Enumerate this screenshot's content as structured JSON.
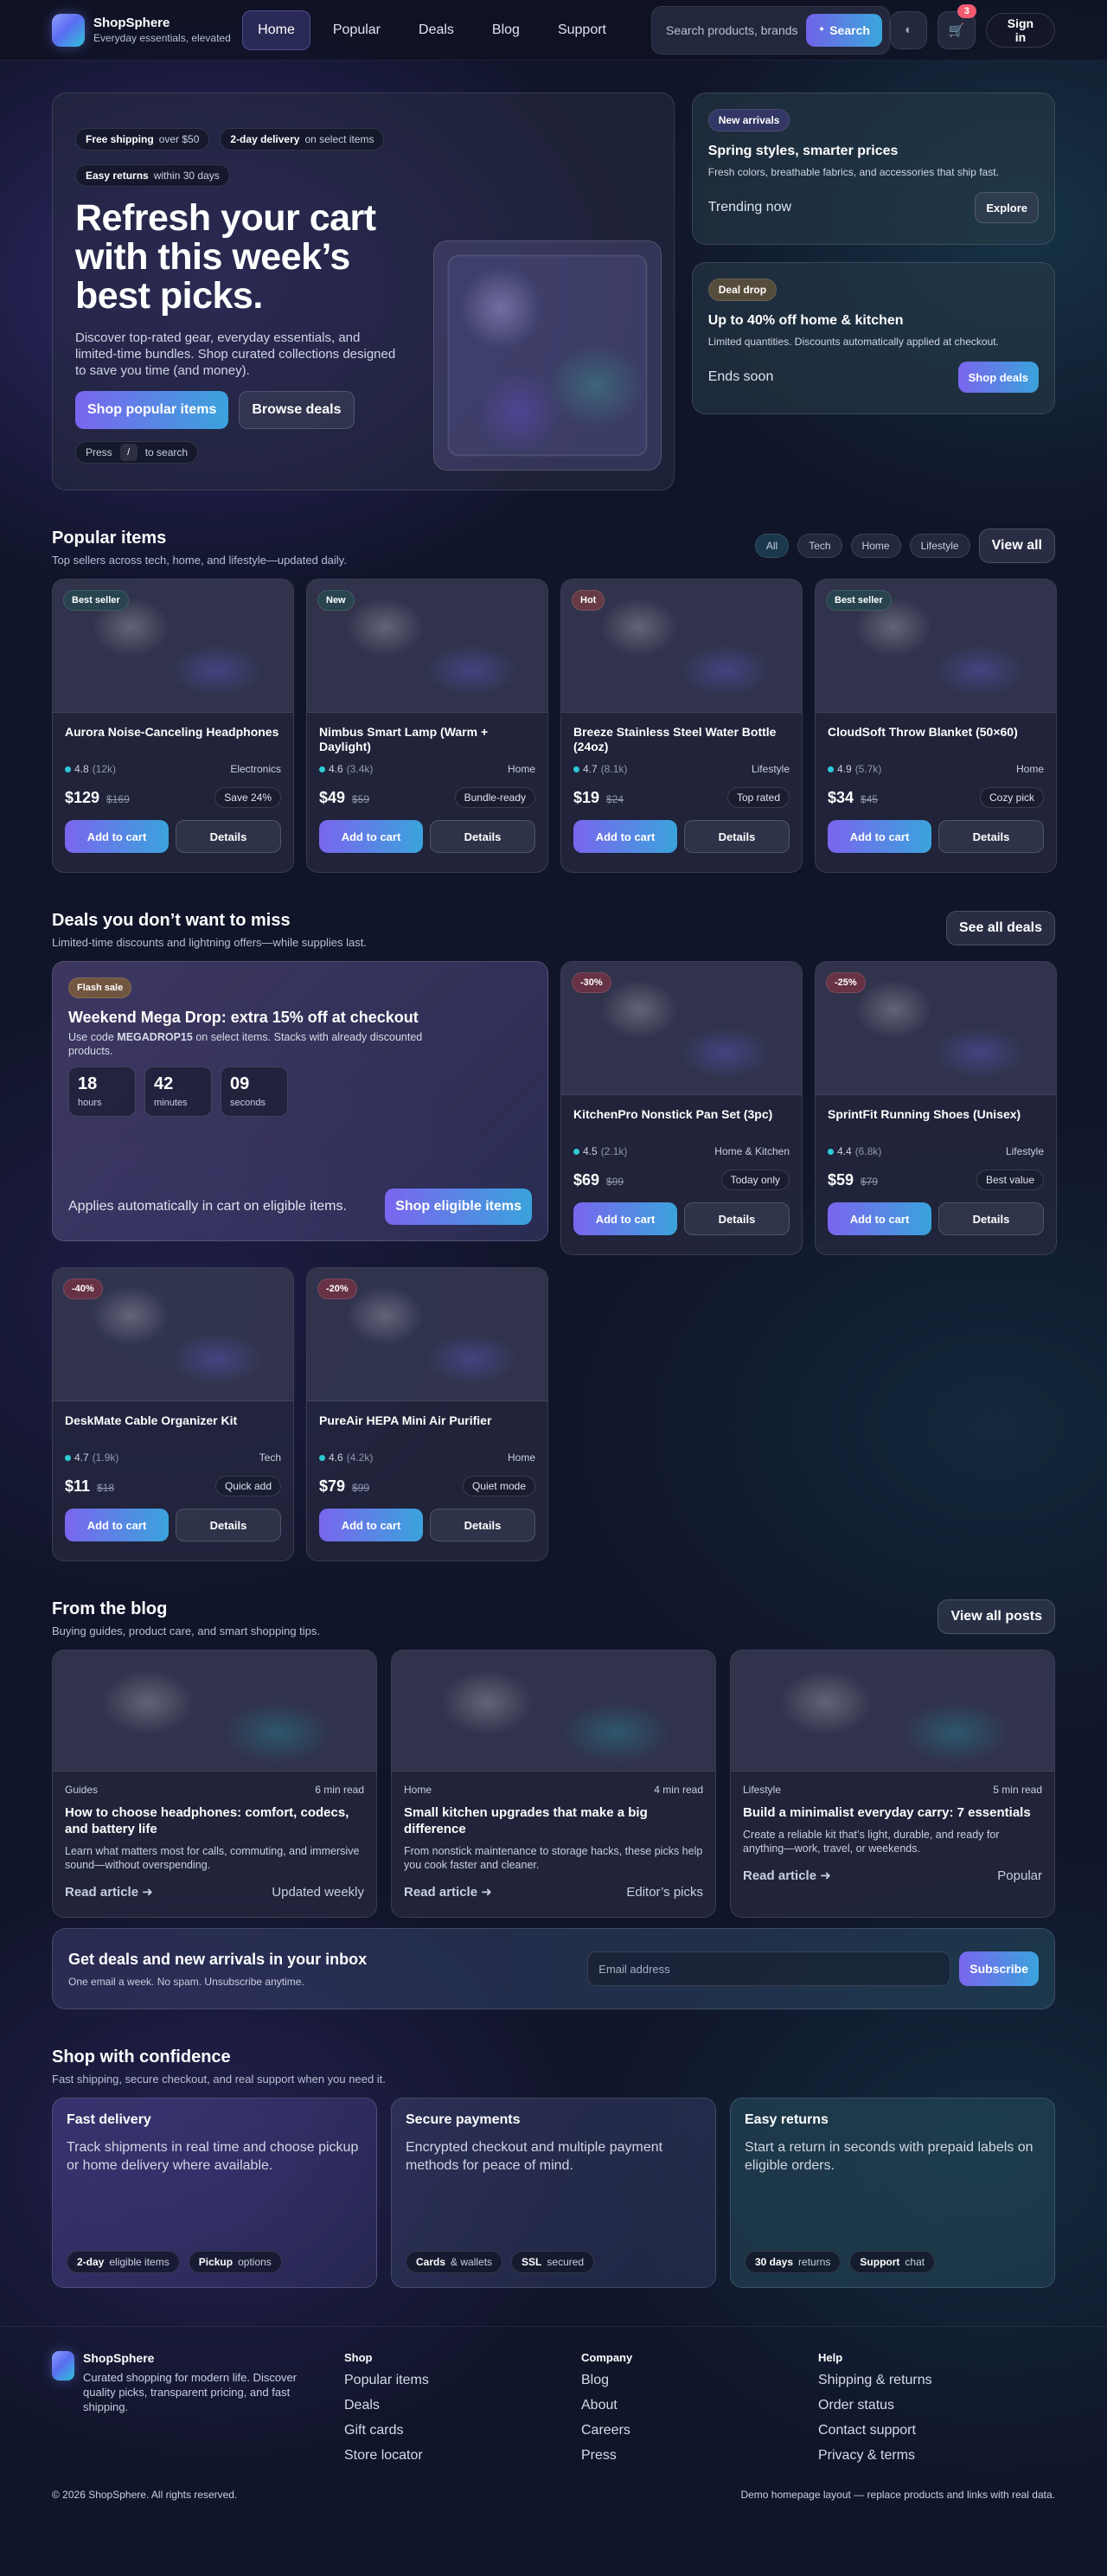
{
  "header": {
    "brand": "ShopSphere",
    "tagline": "Everyday essentials, elevated",
    "nav": [
      "Home",
      "Popular",
      "Deals",
      "Blog",
      "Support"
    ],
    "search_placeholder": "Search products, brands",
    "search_button": "Search",
    "cart_count": "3",
    "signin": "Sign in"
  },
  "hero": {
    "chips": [
      {
        "strong": "Free shipping",
        "text": "over $50"
      },
      {
        "strong": "2-day delivery",
        "text": "on select items"
      },
      {
        "strong": "Easy returns",
        "text": "within 30 days"
      }
    ],
    "title": "Refresh your cart with this week’s best picks.",
    "lead": "Discover top-rated gear, everyday essentials, and limited-time bundles. Shop curated collections designed to save you time (and money).",
    "cta_primary": "Shop popular items",
    "cta_secondary": "Browse deals",
    "hint_pre": "Press",
    "hint_key": "/",
    "hint_post": "to search"
  },
  "promos": [
    {
      "tag": "New arrivals",
      "title": "Spring styles, smarter prices",
      "desc": "Fresh colors, breathable fabrics, and accessories that ship fast.",
      "foot": "Trending now",
      "button": "Explore"
    },
    {
      "tag": "Deal drop",
      "title": "Up to 40% off home & kitchen",
      "desc": "Limited quantities. Discounts automatically applied at checkout.",
      "foot": "Ends soon",
      "button": "Shop deals"
    }
  ],
  "popular": {
    "title": "Popular items",
    "subtitle": "Top sellers across tech, home, and lifestyle—updated daily.",
    "filters": [
      "All",
      "Tech",
      "Home",
      "Lifestyle"
    ],
    "view_all": "View all",
    "products": [
      {
        "tag": "Best seller",
        "name": "Aurora Noise-Canceling Headphones",
        "rating": "4.8",
        "reviews": "(12k)",
        "category": "Electronics",
        "price": "$129",
        "old": "$169",
        "note": "Save 24%"
      },
      {
        "tag": "New",
        "name": "Nimbus Smart Lamp (Warm + Daylight)",
        "rating": "4.6",
        "reviews": "(3.4k)",
        "category": "Home",
        "price": "$49",
        "old": "$59",
        "note": "Bundle-ready"
      },
      {
        "tag": "Hot",
        "name": "Breeze Stainless Steel Water Bottle (24oz)",
        "rating": "4.7",
        "reviews": "(8.1k)",
        "category": "Lifestyle",
        "price": "$19",
        "old": "$24",
        "note": "Top rated"
      },
      {
        "tag": "Best seller",
        "name": "CloudSoft Throw Blanket (50×60)",
        "rating": "4.9",
        "reviews": "(5.7k)",
        "category": "Home",
        "price": "$34",
        "old": "$45",
        "note": "Cozy pick"
      }
    ],
    "add_label": "Add to cart",
    "details_label": "Details"
  },
  "deals": {
    "title": "Deals you don’t want to miss",
    "subtitle": "Limited-time discounts and lightning offers—while supplies last.",
    "see_all": "See all deals",
    "flash": {
      "tag": "Flash sale",
      "title": "Weekend Mega Drop: extra 15% off at checkout",
      "desc_pre": "Use code",
      "code": "MEGADROP15",
      "desc_post": "on select items. Stacks with already discounted products.",
      "timer": [
        {
          "n": "18",
          "l": "hours"
        },
        {
          "n": "42",
          "l": "minutes"
        },
        {
          "n": "09",
          "l": "seconds"
        }
      ],
      "foot": "Applies automatically in cart on eligible items.",
      "button": "Shop eligible items"
    },
    "products": [
      {
        "tag": "-30%",
        "name": "KitchenPro Nonstick Pan Set (3pc)",
        "rating": "4.5",
        "reviews": "(2.1k)",
        "category": "Home & Kitchen",
        "price": "$69",
        "old": "$99",
        "note": "Today only"
      },
      {
        "tag": "-25%",
        "name": "SprintFit Running Shoes (Unisex)",
        "rating": "4.4",
        "reviews": "(6.8k)",
        "category": "Lifestyle",
        "price": "$59",
        "old": "$79",
        "note": "Best value"
      },
      {
        "tag": "-40%",
        "name": "DeskMate Cable Organizer Kit",
        "rating": "4.7",
        "reviews": "(1.9k)",
        "category": "Tech",
        "price": "$11",
        "old": "$18",
        "note": "Quick add"
      },
      {
        "tag": "-20%",
        "name": "PureAir HEPA Mini Air Purifier",
        "rating": "4.6",
        "reviews": "(4.2k)",
        "category": "Home",
        "price": "$79",
        "old": "$99",
        "note": "Quiet mode"
      }
    ]
  },
  "blog": {
    "title": "From the blog",
    "subtitle": "Buying guides, product care, and smart shopping tips.",
    "view_all": "View all posts",
    "posts": [
      {
        "category": "Guides",
        "time": "6 min read",
        "title": "How to choose headphones: comfort, codecs, and battery life",
        "excerpt": "Learn what matters most for calls, commuting, and immersive sound—without overspending.",
        "link": "Read article",
        "label": "Updated weekly"
      },
      {
        "category": "Home",
        "time": "4 min read",
        "title": "Small kitchen upgrades that make a big difference",
        "excerpt": "From nonstick maintenance to storage hacks, these picks help you cook faster and cleaner.",
        "link": "Read article",
        "label": "Editor’s picks"
      },
      {
        "category": "Lifestyle",
        "time": "5 min read",
        "title": "Build a minimalist everyday carry: 7 essentials",
        "excerpt": "Create a reliable kit that’s light, durable, and ready for anything—work, travel, or weekends.",
        "link": "Read article",
        "label": "Popular"
      }
    ]
  },
  "newsletter": {
    "title": "Get deals and new arrivals in your inbox",
    "subtitle": "One email a week. No spam. Unsubscribe anytime.",
    "placeholder": "Email address",
    "button": "Subscribe"
  },
  "confidence": {
    "title": "Shop with confidence",
    "subtitle": "Fast shipping, secure checkout, and real support when you need it.",
    "cards": [
      {
        "title": "Fast delivery",
        "text": "Track shipments in real time and choose pickup or home delivery where available.",
        "chips": [
          {
            "b": "2-day",
            "t": "eligible items"
          },
          {
            "b": "Pickup",
            "t": "options"
          }
        ]
      },
      {
        "title": "Secure payments",
        "text": "Encrypted checkout and multiple payment methods for peace of mind.",
        "chips": [
          {
            "b": "Cards",
            "t": "& wallets"
          },
          {
            "b": "SSL",
            "t": "secured"
          }
        ]
      },
      {
        "title": "Easy returns",
        "text": "Start a return in seconds with prepaid labels on eligible orders.",
        "chips": [
          {
            "b": "30 days",
            "t": "returns"
          },
          {
            "b": "Support",
            "t": "chat"
          }
        ]
      }
    ]
  },
  "footer": {
    "brand": "ShopSphere",
    "desc": "Curated shopping for modern life. Discover quality picks, transparent pricing, and fast shipping.",
    "columns": [
      {
        "title": "Shop",
        "links": [
          "Popular items",
          "Deals",
          "Gift cards",
          "Store locator"
        ]
      },
      {
        "title": "Company",
        "links": [
          "Blog",
          "About",
          "Careers",
          "Press"
        ]
      },
      {
        "title": "Help",
        "links": [
          "Shipping & returns",
          "Order status",
          "Contact support",
          "Privacy & terms"
        ]
      }
    ],
    "copyright": "© 2026 ShopSphere. All rights reserved.",
    "note": "Demo homepage layout — replace products and links with real data."
  }
}
